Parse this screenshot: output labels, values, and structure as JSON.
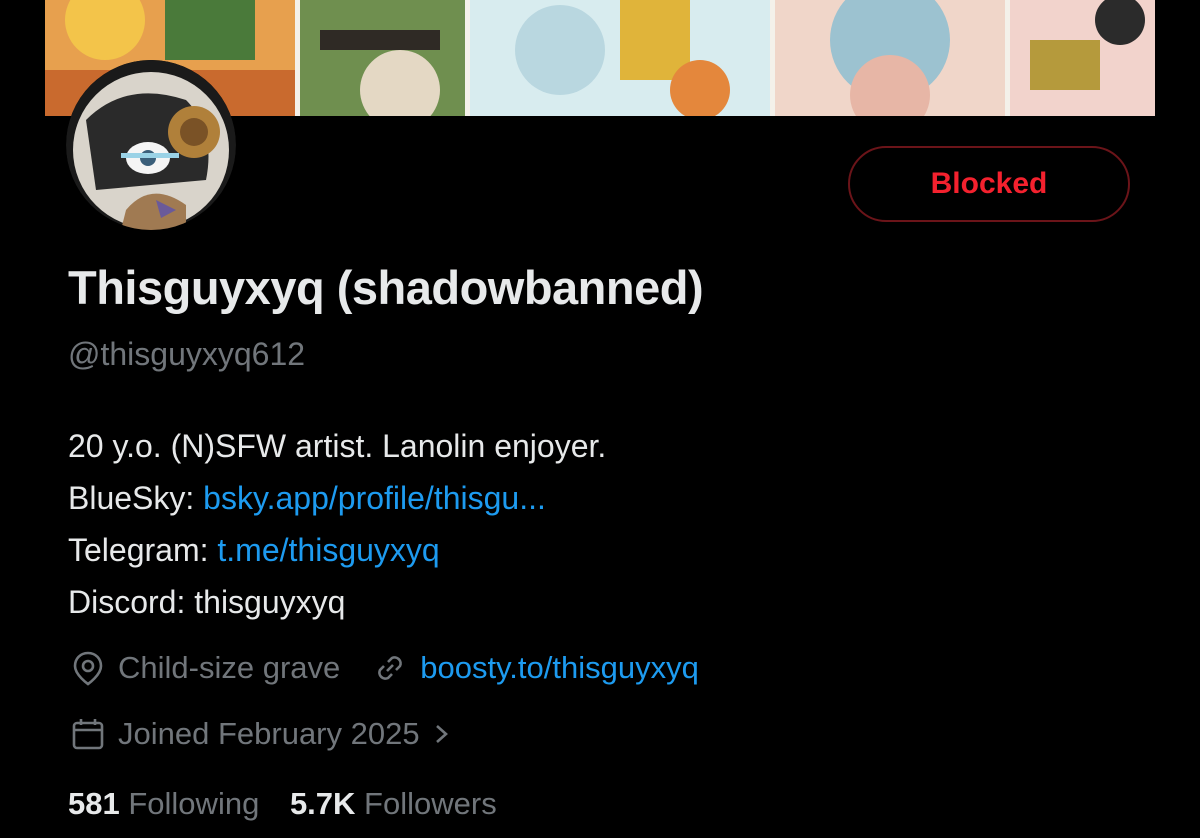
{
  "profile": {
    "action_button": "Blocked",
    "display_name": "Thisguyxyq (shadowbanned)",
    "handle": "@thisguyxyq612",
    "bio": {
      "line1": "20 y.o. (N)SFW artist. Lanolin enjoyer.",
      "bluesky_label": "BlueSky: ",
      "bluesky_link": "bsky.app/profile/thisgu...",
      "telegram_label": "Telegram: ",
      "telegram_link": "t.me/thisguyxyq",
      "discord": "Discord: thisguyxyq"
    },
    "location": "Child-size grave",
    "website": "boosty.to/thisguyxyq",
    "joined": "Joined February 2025",
    "following_count": "581",
    "following_label": "Following",
    "followers_count": "5.7K",
    "followers_label": "Followers"
  },
  "colors": {
    "background": "#000000",
    "text_primary": "#e7e9ea",
    "text_secondary": "#71767b",
    "link": "#1d9bf0",
    "blocked_red": "#f4212e"
  },
  "icons": {
    "location": "location-pin-icon",
    "website": "link-icon",
    "joined": "calendar-icon",
    "joined_arrow": "chevron-right-icon"
  }
}
